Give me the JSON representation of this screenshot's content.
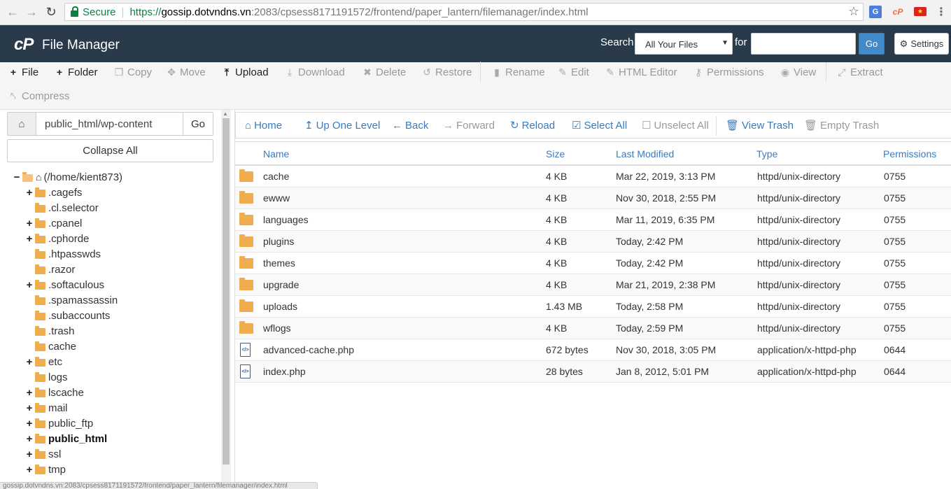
{
  "browser": {
    "secure_label": "Secure",
    "url_scheme": "https://",
    "url_host": "gossip.dotvndns.vn",
    "url_rest": ":2083/cpsess8171191572/frontend/paper_lantern/filemanager/index.html",
    "status_url": "gossip.dotvndns.vn:2083/cpsess8171191572/frontend/paper_lantern/filemanager/index.html"
  },
  "header": {
    "logo": "cP",
    "title": "File Manager",
    "search_label": "Search",
    "search_scope": "All Your Files",
    "for_label": "for",
    "search_value": "",
    "go_label": "Go",
    "settings_label": "Settings"
  },
  "toolbar": {
    "file": "File",
    "folder": "Folder",
    "copy": "Copy",
    "move": "Move",
    "upload": "Upload",
    "download": "Download",
    "delete": "Delete",
    "restore": "Restore",
    "rename": "Rename",
    "edit": "Edit",
    "html_editor": "HTML Editor",
    "permissions": "Permissions",
    "view": "View",
    "extract": "Extract",
    "compress": "Compress"
  },
  "sidebar": {
    "path_value": "public_html/wp-content",
    "go_label": "Go",
    "collapse_label": "Collapse All",
    "root_label": "(/home/kient873)",
    "items": [
      {
        "label": ".cagefs",
        "expandable": true
      },
      {
        "label": ".cl.selector",
        "expandable": false
      },
      {
        "label": ".cpanel",
        "expandable": true
      },
      {
        "label": ".cphorde",
        "expandable": true
      },
      {
        "label": ".htpasswds",
        "expandable": false
      },
      {
        "label": ".razor",
        "expandable": false
      },
      {
        "label": ".softaculous",
        "expandable": true
      },
      {
        "label": ".spamassassin",
        "expandable": false
      },
      {
        "label": ".subaccounts",
        "expandable": false
      },
      {
        "label": ".trash",
        "expandable": false
      },
      {
        "label": "cache",
        "expandable": false
      },
      {
        "label": "etc",
        "expandable": true
      },
      {
        "label": "logs",
        "expandable": false
      },
      {
        "label": "lscache",
        "expandable": true
      },
      {
        "label": "mail",
        "expandable": true
      },
      {
        "label": "public_ftp",
        "expandable": true
      },
      {
        "label": "public_html",
        "expandable": true,
        "bold": true
      },
      {
        "label": "ssl",
        "expandable": true
      },
      {
        "label": "tmp",
        "expandable": true
      }
    ]
  },
  "nav": {
    "home": "Home",
    "up_one_level": "Up One Level",
    "back": "Back",
    "forward": "Forward",
    "reload": "Reload",
    "select_all": "Select All",
    "unselect_all": "Unselect All",
    "view_trash": "View Trash",
    "empty_trash": "Empty Trash"
  },
  "table": {
    "columns": [
      "Name",
      "Size",
      "Last Modified",
      "Type",
      "Permissions"
    ],
    "rows": [
      {
        "kind": "folder",
        "name": "cache",
        "size": "4 KB",
        "modified": "Mar 22, 2019, 3:13 PM",
        "type": "httpd/unix-directory",
        "perm": "0755"
      },
      {
        "kind": "folder",
        "name": "ewww",
        "size": "4 KB",
        "modified": "Nov 30, 2018, 2:55 PM",
        "type": "httpd/unix-directory",
        "perm": "0755"
      },
      {
        "kind": "folder",
        "name": "languages",
        "size": "4 KB",
        "modified": "Mar 11, 2019, 6:35 PM",
        "type": "httpd/unix-directory",
        "perm": "0755"
      },
      {
        "kind": "folder",
        "name": "plugins",
        "size": "4 KB",
        "modified": "Today, 2:42 PM",
        "type": "httpd/unix-directory",
        "perm": "0755"
      },
      {
        "kind": "folder",
        "name": "themes",
        "size": "4 KB",
        "modified": "Today, 2:42 PM",
        "type": "httpd/unix-directory",
        "perm": "0755"
      },
      {
        "kind": "folder",
        "name": "upgrade",
        "size": "4 KB",
        "modified": "Mar 21, 2019, 2:38 PM",
        "type": "httpd/unix-directory",
        "perm": "0755"
      },
      {
        "kind": "folder",
        "name": "uploads",
        "size": "1.43 MB",
        "modified": "Today, 2:58 PM",
        "type": "httpd/unix-directory",
        "perm": "0755"
      },
      {
        "kind": "folder",
        "name": "wflogs",
        "size": "4 KB",
        "modified": "Today, 2:59 PM",
        "type": "httpd/unix-directory",
        "perm": "0755"
      },
      {
        "kind": "file",
        "name": "advanced-cache.php",
        "size": "672 bytes",
        "modified": "Nov 30, 2018, 3:05 PM",
        "type": "application/x-httpd-php",
        "perm": "0644"
      },
      {
        "kind": "file",
        "name": "index.php",
        "size": "28 bytes",
        "modified": "Jan 8, 2012, 5:01 PM",
        "type": "application/x-httpd-php",
        "perm": "0644"
      }
    ]
  },
  "colors": {
    "header_bg": "#293a4a",
    "accent": "#3a7bbf",
    "folder": "#f0ad4e",
    "go_button": "#428bca"
  }
}
